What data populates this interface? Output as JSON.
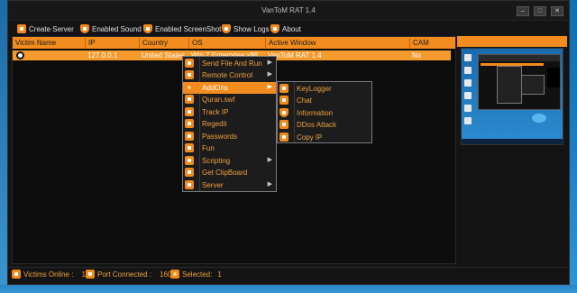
{
  "window": {
    "title": "VanToM RAT 1.4",
    "buttons": [
      "–",
      "□",
      "✕"
    ]
  },
  "menu": [
    {
      "label": "Create Server",
      "icon": "wrench-icon"
    },
    {
      "label": "Enabled Sound",
      "icon": "shield-icon"
    },
    {
      "label": "Enabled ScreenShot",
      "icon": "shield-icon"
    },
    {
      "label": "Show Logs",
      "icon": "shield-icon"
    },
    {
      "label": "About",
      "icon": "shield-icon"
    }
  ],
  "grid": {
    "columns": [
      "Victim Name",
      "IP",
      "Country",
      "OS",
      "Active Window",
      "CAM"
    ],
    "rows": [
      {
        "name": "",
        "ip": "127.0.0.1",
        "country": "United States",
        "os": "Win 7 Enterprise x86",
        "active_window": "VanToM RAT 1.4",
        "cam": "No"
      }
    ]
  },
  "context_menu": {
    "items": [
      {
        "label": "Send File And Run",
        "icon": "send-icon",
        "submenu": true
      },
      {
        "label": "Remote Control",
        "icon": "remote-icon",
        "submenu": true
      },
      {
        "label": "AddOns",
        "icon": "star-icon",
        "submenu": true,
        "highlighted": true
      },
      {
        "label": "Quran.swf",
        "icon": "file-icon",
        "submenu": false
      },
      {
        "label": "Track IP",
        "icon": "track-icon",
        "submenu": false
      },
      {
        "label": "Regedit",
        "icon": "regedit-icon",
        "submenu": false
      },
      {
        "label": "Passwords",
        "icon": "key-icon",
        "submenu": false
      },
      {
        "label": "Fun",
        "icon": "fun-icon",
        "submenu": false
      },
      {
        "label": "Scripting",
        "icon": "script-icon",
        "submenu": true
      },
      {
        "label": "Get ClipBoard",
        "icon": "clipboard-icon",
        "submenu": false
      },
      {
        "label": "Server",
        "icon": "server-icon",
        "submenu": true
      }
    ],
    "arrow": "▶"
  },
  "addons_menu": {
    "items": [
      {
        "label": "KeyLogger",
        "icon": "keylogger-icon"
      },
      {
        "label": "Chat",
        "icon": "chat-icon"
      },
      {
        "label": "Information",
        "icon": "info-icon"
      },
      {
        "label": "DDos Attack",
        "icon": "ddos-icon"
      },
      {
        "label": "Copy IP",
        "icon": "copy-icon"
      }
    ]
  },
  "status": {
    "victims_label": "Victims Online :",
    "victims_value": "1",
    "port_label": "Port Connected :",
    "port_value": "1604",
    "selected_label": "Selected:",
    "selected_value": "1"
  },
  "colors": {
    "accent": "#f28c1e",
    "window_bg": "#141414",
    "desktop": "#1a7cc2"
  }
}
